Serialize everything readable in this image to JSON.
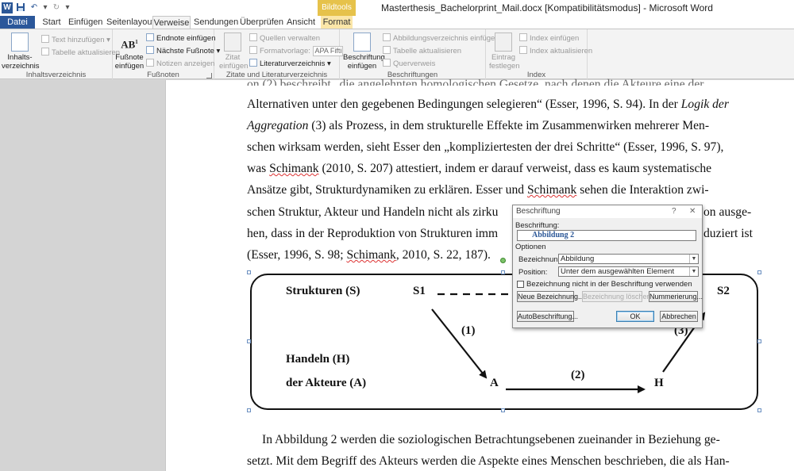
{
  "window": {
    "title": "Masterthesis_Bachelorprint_Mail.docx [Kompatibilitätsmodus] - Microsoft Word",
    "contextual_group": "Bildtools"
  },
  "qat": {
    "word": "W",
    "save": "💾",
    "undo": "↶",
    "redo": "↻",
    "more": "▾"
  },
  "tabs": [
    {
      "label": "Datei"
    },
    {
      "label": "Start"
    },
    {
      "label": "Einfügen"
    },
    {
      "label": "Seitenlayout"
    },
    {
      "label": "Verweise"
    },
    {
      "label": "Sendungen"
    },
    {
      "label": "Überprüfen"
    },
    {
      "label": "Ansicht"
    },
    {
      "label": "Format"
    }
  ],
  "ribbon": {
    "toc": {
      "label": "Inhaltsverzeichnis",
      "big": "Inhalts-\nverzeichnis",
      "add_text": "Text hinzufügen",
      "update_table": "Tabelle aktualisieren"
    },
    "footnotes": {
      "label": "Fußnoten",
      "insert": "Fußnote\neinfügen",
      "insert_endnote": "Endnote einfügen",
      "next_footnote": "Nächste Fußnote",
      "show_notes": "Notizen anzeigen"
    },
    "citations": {
      "label": "Zitate und Literaturverzeichnis",
      "insert_citation": "Zitat\neinfügen",
      "manage_sources": "Quellen verwalten",
      "style_label": "Formatvorlage:",
      "style_value": "APA Fifti",
      "bibliography": "Literaturverzeichnis"
    },
    "captions": {
      "label": "Beschriftungen",
      "insert_caption": "Beschriftung\neinfügen",
      "insert_tof": "Abbildungsverzeichnis einfügen",
      "update_table": "Tabelle aktualisieren",
      "cross_ref": "Querverweis"
    },
    "index": {
      "label": "Index",
      "mark_entry": "Eintrag\nfestlegen",
      "insert_index": "Index einfügen",
      "update_index": "Index aktualisieren"
    }
  },
  "document": {
    "lines": [
      "Alternativen unter den gegebenen Bedingungen selegieren“ (Esser, 1996, S. 94). In der",
      "Logik der Aggregation",
      "(3) als Prozess, in dem strukturelle Effekte im Zusammenwirken mehrerer Men-",
      "schen wirksam werden, sieht Esser den „kompliziertesten der drei Schritte“ (Esser, 1996, S. 97),",
      "was",
      "Schimank",
      "(2010, S. 207) attestiert, indem er darauf verweist, dass es kaum systematische",
      "Ansätze gibt, Strukturdynamiken zu erklären. Esser und",
      "Schimank",
      "sehen die Interaktion zwi-",
      "schen Struktur, Akteur und Handeln nicht als zirku",
      "on ausge-",
      "hen, dass in der Reproduktion von Strukturen imm",
      "duziert ist",
      "(Esser, 1996, S. 98;",
      "Schimank",
      ", 2010, S. 22, 187).",
      "In Abbildung 2 werden die soziologischen Betrachtungsebenen zueinander in Beziehung ge-",
      "setzt. Mit dem Begriff des Akteurs werden die Aspekte eines Menschen beschrieben, die als Han-"
    ],
    "top_fragment": "on (2) beschreibt „die angelehnten homologischen Gesetze, nach denen die Akteure eine der"
  },
  "figure": {
    "strukturen": "Strukturen (S)",
    "handeln": "Handeln (H)",
    "akteure": "der Akteure (A)",
    "s1": "S1",
    "s2": "S2",
    "a": "A",
    "h": "H",
    "step1": "(1)",
    "step2": "(2)",
    "step3": "(3)"
  },
  "dialog": {
    "title": "Beschriftung",
    "help": "?",
    "close": "✕",
    "caption_label": "Beschriftung:",
    "caption_value": "Abbildung 2",
    "options_label": "Optionen",
    "label_label": "Bezeichnung:",
    "label_value": "Abbildung",
    "position_label": "Position:",
    "position_value": "Unter dem ausgewählten Element",
    "exclude_label": "Bezeichnung nicht in der Beschriftung verwenden",
    "new_label": "Neue Bezeichnung...",
    "delete_label": "Bezeichnung löschen",
    "numbering": "Nummerierung...",
    "autocaption": "AutoBeschriftung...",
    "ok": "OK",
    "cancel": "Abbrechen"
  }
}
